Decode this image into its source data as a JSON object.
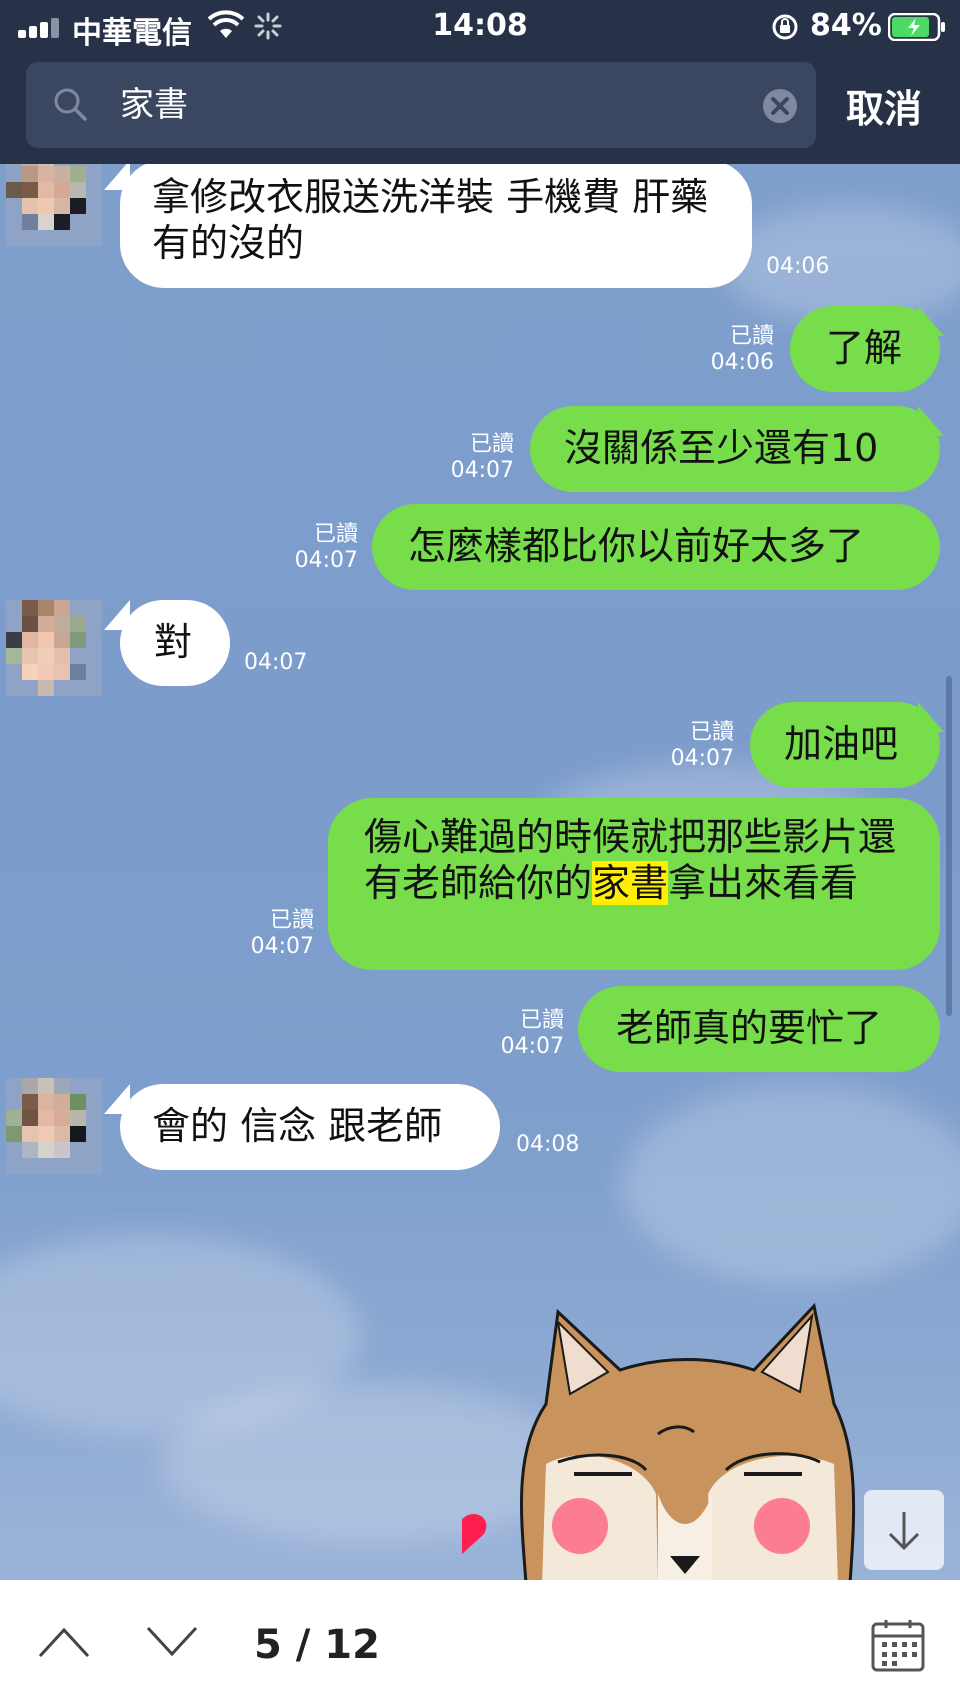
{
  "status_bar": {
    "carrier": "中華電信",
    "time": "14:08",
    "battery_percent": "84%",
    "battery_level": 0.84
  },
  "search": {
    "query": "家書",
    "cancel_label": "取消"
  },
  "messages": [
    {
      "side": "in",
      "text": "拿修改衣服送洗洋裝 手機費 肝藥 有的沒的",
      "time": "04:06"
    },
    {
      "side": "out",
      "text": "了解",
      "read": "已讀",
      "time": "04:06"
    },
    {
      "side": "out",
      "text": "沒關係至少還有10",
      "read": "已讀",
      "time": "04:07"
    },
    {
      "side": "out",
      "text": "怎麼樣都比你以前好太多了",
      "read": "已讀",
      "time": "04:07"
    },
    {
      "side": "in",
      "text": "對",
      "time": "04:07"
    },
    {
      "side": "out",
      "text": "加油吧",
      "read": "已讀",
      "time": "04:07"
    },
    {
      "side": "out",
      "text_before": "傷心難過的時候就把那些影片還有老師給你的",
      "text_highlight": "家書",
      "text_after": "拿出來看看",
      "read": "已讀",
      "time": "04:07"
    },
    {
      "side": "out",
      "text": "老師真的要忙了",
      "read": "已讀",
      "time": "04:07"
    },
    {
      "side": "in",
      "text": "會的 信念 跟老師",
      "time": "04:08"
    }
  ],
  "bottom_bar": {
    "counter": "5 / 12"
  },
  "colors": {
    "header_bg": "#273248",
    "chat_bg": "#7d9ecd",
    "bubble_out": "#77dd4a",
    "bubble_in": "#ffffff",
    "highlight": "#ffee00"
  },
  "icons": [
    "signal-icon",
    "wifi-icon",
    "loading-icon",
    "rotation-lock-icon",
    "battery-icon",
    "search-icon",
    "clear-icon",
    "scroll-down-icon",
    "chevron-up-icon",
    "chevron-down-icon",
    "calendar-icon"
  ]
}
